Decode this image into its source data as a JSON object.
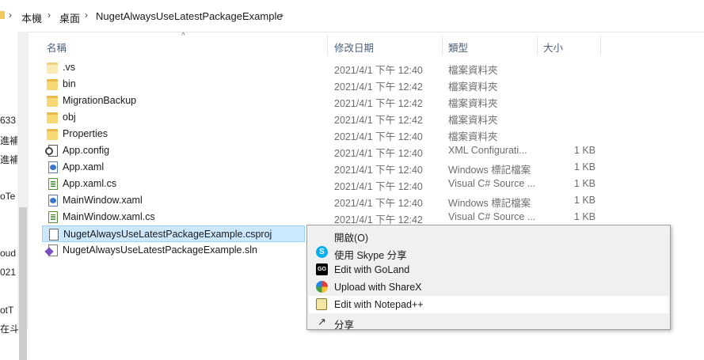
{
  "breadcrumb": {
    "items": [
      "本機",
      "桌面",
      "NugetAlwaysUseLatestPackageExample"
    ]
  },
  "nav_pane_fragments": [
    "633",
    "進補",
    "進補",
    "oTe",
    "oud",
    "021",
    "otT",
    "在斗"
  ],
  "columns": {
    "name": "名稱",
    "date": "修改日期",
    "type": "類型",
    "size": "大小"
  },
  "files": [
    {
      "name": ".vs",
      "date": "2021/4/1 下午 12:40",
      "type": "檔案資料夾",
      "size": "",
      "icon": "folder-hidden-icon"
    },
    {
      "name": "bin",
      "date": "2021/4/1 下午 12:42",
      "type": "檔案資料夾",
      "size": "",
      "icon": "folder-icon"
    },
    {
      "name": "MigrationBackup",
      "date": "2021/4/1 下午 12:42",
      "type": "檔案資料夾",
      "size": "",
      "icon": "folder-icon"
    },
    {
      "name": "obj",
      "date": "2021/4/1 下午 12:42",
      "type": "檔案資料夾",
      "size": "",
      "icon": "folder-icon"
    },
    {
      "name": "Properties",
      "date": "2021/4/1 下午 12:40",
      "type": "檔案資料夾",
      "size": "",
      "icon": "folder-icon"
    },
    {
      "name": "App.config",
      "date": "2021/4/1 下午 12:40",
      "type": "XML Configurati...",
      "size": "1 KB",
      "icon": "config-file-icon"
    },
    {
      "name": "App.xaml",
      "date": "2021/4/1 下午 12:40",
      "type": "Windows 標記檔案",
      "size": "1 KB",
      "icon": "xaml-file-icon"
    },
    {
      "name": "App.xaml.cs",
      "date": "2021/4/1 下午 12:40",
      "type": "Visual C# Source ...",
      "size": "1 KB",
      "icon": "csharp-file-icon"
    },
    {
      "name": "MainWindow.xaml",
      "date": "2021/4/1 下午 12:40",
      "type": "Windows 標記檔案",
      "size": "1 KB",
      "icon": "xaml-file-icon"
    },
    {
      "name": "MainWindow.xaml.cs",
      "date": "2021/4/1 下午 12:42",
      "type": "Visual C# Source ...",
      "size": "1 KB",
      "icon": "csharp-file-icon"
    },
    {
      "name": "NugetAlwaysUseLatestPackageExample.csproj",
      "date": "",
      "type": "",
      "size": "",
      "icon": "csproj-file-icon"
    },
    {
      "name": "NugetAlwaysUseLatestPackageExample.sln",
      "date": "",
      "type": "",
      "size": "",
      "icon": "sln-file-icon"
    }
  ],
  "context_menu": {
    "items": [
      {
        "label": "開啟(O)",
        "icon": ""
      },
      {
        "label": "使用 Skype 分享",
        "icon": "skype-icon"
      },
      {
        "label": "Edit with GoLand",
        "icon": "goland-icon"
      },
      {
        "label": "Upload with ShareX",
        "icon": "sharex-icon"
      },
      {
        "label": "Edit with Notepad++",
        "icon": "notepadpp-icon"
      },
      {
        "label": "分享",
        "icon": "share-icon"
      }
    ]
  },
  "colors": {
    "selection_bg": "#cce8ff",
    "selection_border": "#99d1ff",
    "menu_bg": "#f0f0f0",
    "header_text": "#4c607a"
  }
}
